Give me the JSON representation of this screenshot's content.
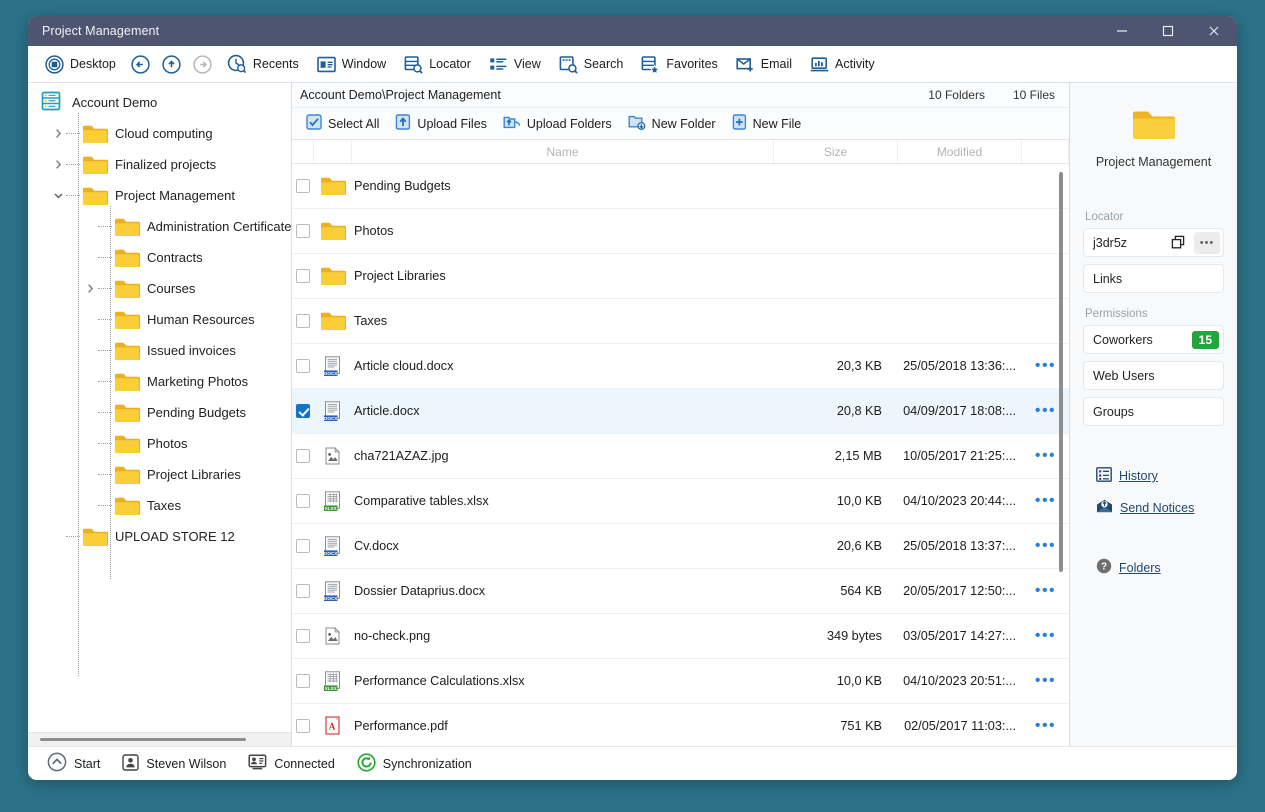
{
  "window": {
    "title": "Project Management",
    "controls": {
      "minimize": "minimize-button",
      "maximize": "maximize-button",
      "close": "close-button"
    }
  },
  "toolbar": {
    "items": [
      {
        "label": "Desktop",
        "icon": "desktop-icon"
      },
      {
        "label": "",
        "icon": "back-arrow-icon"
      },
      {
        "label": "",
        "icon": "up-arrow-icon"
      },
      {
        "label": "",
        "icon": "forward-arrow-icon"
      },
      {
        "label": "Recents",
        "icon": "recents-clock-icon"
      },
      {
        "label": "Window",
        "icon": "window-icon"
      },
      {
        "label": "Locator",
        "icon": "locator-icon"
      },
      {
        "label": "View",
        "icon": "view-list-icon"
      },
      {
        "label": "Search",
        "icon": "search-icon"
      },
      {
        "label": "Favorites",
        "icon": "favorites-star-icon"
      },
      {
        "label": "Email",
        "icon": "email-icon"
      },
      {
        "label": "Activity",
        "icon": "activity-chart-icon"
      }
    ]
  },
  "tree": {
    "root": {
      "label": "Account Demo",
      "icon": "server-icon"
    },
    "items": [
      {
        "label": "Cloud computing",
        "depth": 1,
        "expander": "collapsed"
      },
      {
        "label": "Finalized projects",
        "depth": 1,
        "expander": "collapsed"
      },
      {
        "label": "Project Management",
        "depth": 1,
        "expander": "expanded",
        "selected": true
      },
      {
        "label": "Administration Certificates",
        "depth": 2,
        "expander": "none"
      },
      {
        "label": "Contracts",
        "depth": 2,
        "expander": "none"
      },
      {
        "label": "Courses",
        "depth": 2,
        "expander": "collapsed"
      },
      {
        "label": "Human Resources",
        "depth": 2,
        "expander": "none"
      },
      {
        "label": "Issued invoices",
        "depth": 2,
        "expander": "none"
      },
      {
        "label": "Marketing Photos",
        "depth": 2,
        "expander": "none"
      },
      {
        "label": "Pending Budgets",
        "depth": 2,
        "expander": "none"
      },
      {
        "label": "Photos",
        "depth": 2,
        "expander": "none"
      },
      {
        "label": "Project Libraries",
        "depth": 2,
        "expander": "none"
      },
      {
        "label": "Taxes",
        "depth": 2,
        "expander": "none"
      },
      {
        "label": "UPLOAD STORE 12",
        "depth": 1,
        "expander": "none"
      }
    ]
  },
  "main": {
    "path": "Account Demo\\Project Management",
    "folder_count": "10 Folders",
    "file_count": "10 Files",
    "actions": [
      {
        "label": "Select All",
        "icon": "select-all-checkbox-icon"
      },
      {
        "label": "Upload Files",
        "icon": "upload-files-icon"
      },
      {
        "label": "Upload Folders",
        "icon": "upload-folders-icon"
      },
      {
        "label": "New Folder",
        "icon": "new-folder-icon"
      },
      {
        "label": "New File",
        "icon": "new-file-icon"
      }
    ],
    "columns": {
      "name": "Name",
      "size": "Size",
      "modified": "Modified"
    },
    "rows": [
      {
        "name": "Pending Budgets",
        "type": "folder",
        "size": "",
        "modified": "",
        "checked": false,
        "menu": ""
      },
      {
        "name": "Photos",
        "type": "folder",
        "size": "",
        "modified": "",
        "checked": false,
        "menu": ""
      },
      {
        "name": "Project Libraries",
        "type": "folder",
        "size": "",
        "modified": "",
        "checked": false,
        "menu": ""
      },
      {
        "name": "Taxes",
        "type": "folder",
        "size": "",
        "modified": "",
        "checked": false,
        "menu": ""
      },
      {
        "name": "Article cloud.docx",
        "type": "docx",
        "size": "20,3 KB",
        "modified": "25/05/2018 13:36:...",
        "checked": false,
        "menu": "•••"
      },
      {
        "name": "Article.docx",
        "type": "docx",
        "size": "20,8 KB",
        "modified": "04/09/2017 18:08:...",
        "checked": true,
        "menu": "•••"
      },
      {
        "name": "cha721AZAZ.jpg",
        "type": "image",
        "size": "2,15 MB",
        "modified": "10/05/2017 21:25:...",
        "checked": false,
        "menu": "•••"
      },
      {
        "name": "Comparative tables.xlsx",
        "type": "xlsx",
        "size": "10,0 KB",
        "modified": "04/10/2023 20:44:...",
        "checked": false,
        "menu": "•••"
      },
      {
        "name": "Cv.docx",
        "type": "docx",
        "size": "20,6 KB",
        "modified": "25/05/2018 13:37:...",
        "checked": false,
        "menu": "•••"
      },
      {
        "name": "Dossier Dataprius.docx",
        "type": "docx",
        "size": "564 KB",
        "modified": "20/05/2017 12:50:...",
        "checked": false,
        "menu": "•••"
      },
      {
        "name": "no-check.png",
        "type": "image",
        "size": "349 bytes",
        "modified": "03/05/2017 14:27:...",
        "checked": false,
        "menu": "•••"
      },
      {
        "name": "Performance Calculations.xlsx",
        "type": "xlsx",
        "size": "10,0 KB",
        "modified": "04/10/2023 20:51:...",
        "checked": false,
        "menu": "•••"
      },
      {
        "name": "Performance.pdf",
        "type": "pdf",
        "size": "751 KB",
        "modified": "02/05/2017 11:03:...",
        "checked": false,
        "menu": "•••"
      }
    ]
  },
  "rightpanel": {
    "folder_title": "Project Management",
    "locator_label": "Locator",
    "locator_value": "j3dr5z",
    "locator_more": "•••",
    "links_label": "Links",
    "permissions_label": "Permissions",
    "permissions": [
      {
        "label": "Coworkers",
        "count": "15"
      },
      {
        "label": "Web Users",
        "count": ""
      },
      {
        "label": "Groups",
        "count": ""
      }
    ],
    "links": [
      {
        "label": "History",
        "icon": "history-list-icon"
      },
      {
        "label": "Send Notices",
        "icon": "send-notices-envelope-icon"
      },
      {
        "label": "Folders",
        "icon": "help-question-icon"
      }
    ]
  },
  "statusbar": {
    "items": [
      {
        "label": "Start",
        "icon": "start-chevron-icon"
      },
      {
        "label": "Steven Wilson",
        "icon": "user-icon"
      },
      {
        "label": "Connected",
        "icon": "connected-icon"
      },
      {
        "label": "Synchronization",
        "icon": "sync-icon"
      }
    ]
  },
  "colors": {
    "accent": "#1f6fb8",
    "titlebar": "#4d5570",
    "desktop": "#2c7188",
    "badge_green": "#25a33c",
    "folder_yellow": "#f5c518"
  }
}
